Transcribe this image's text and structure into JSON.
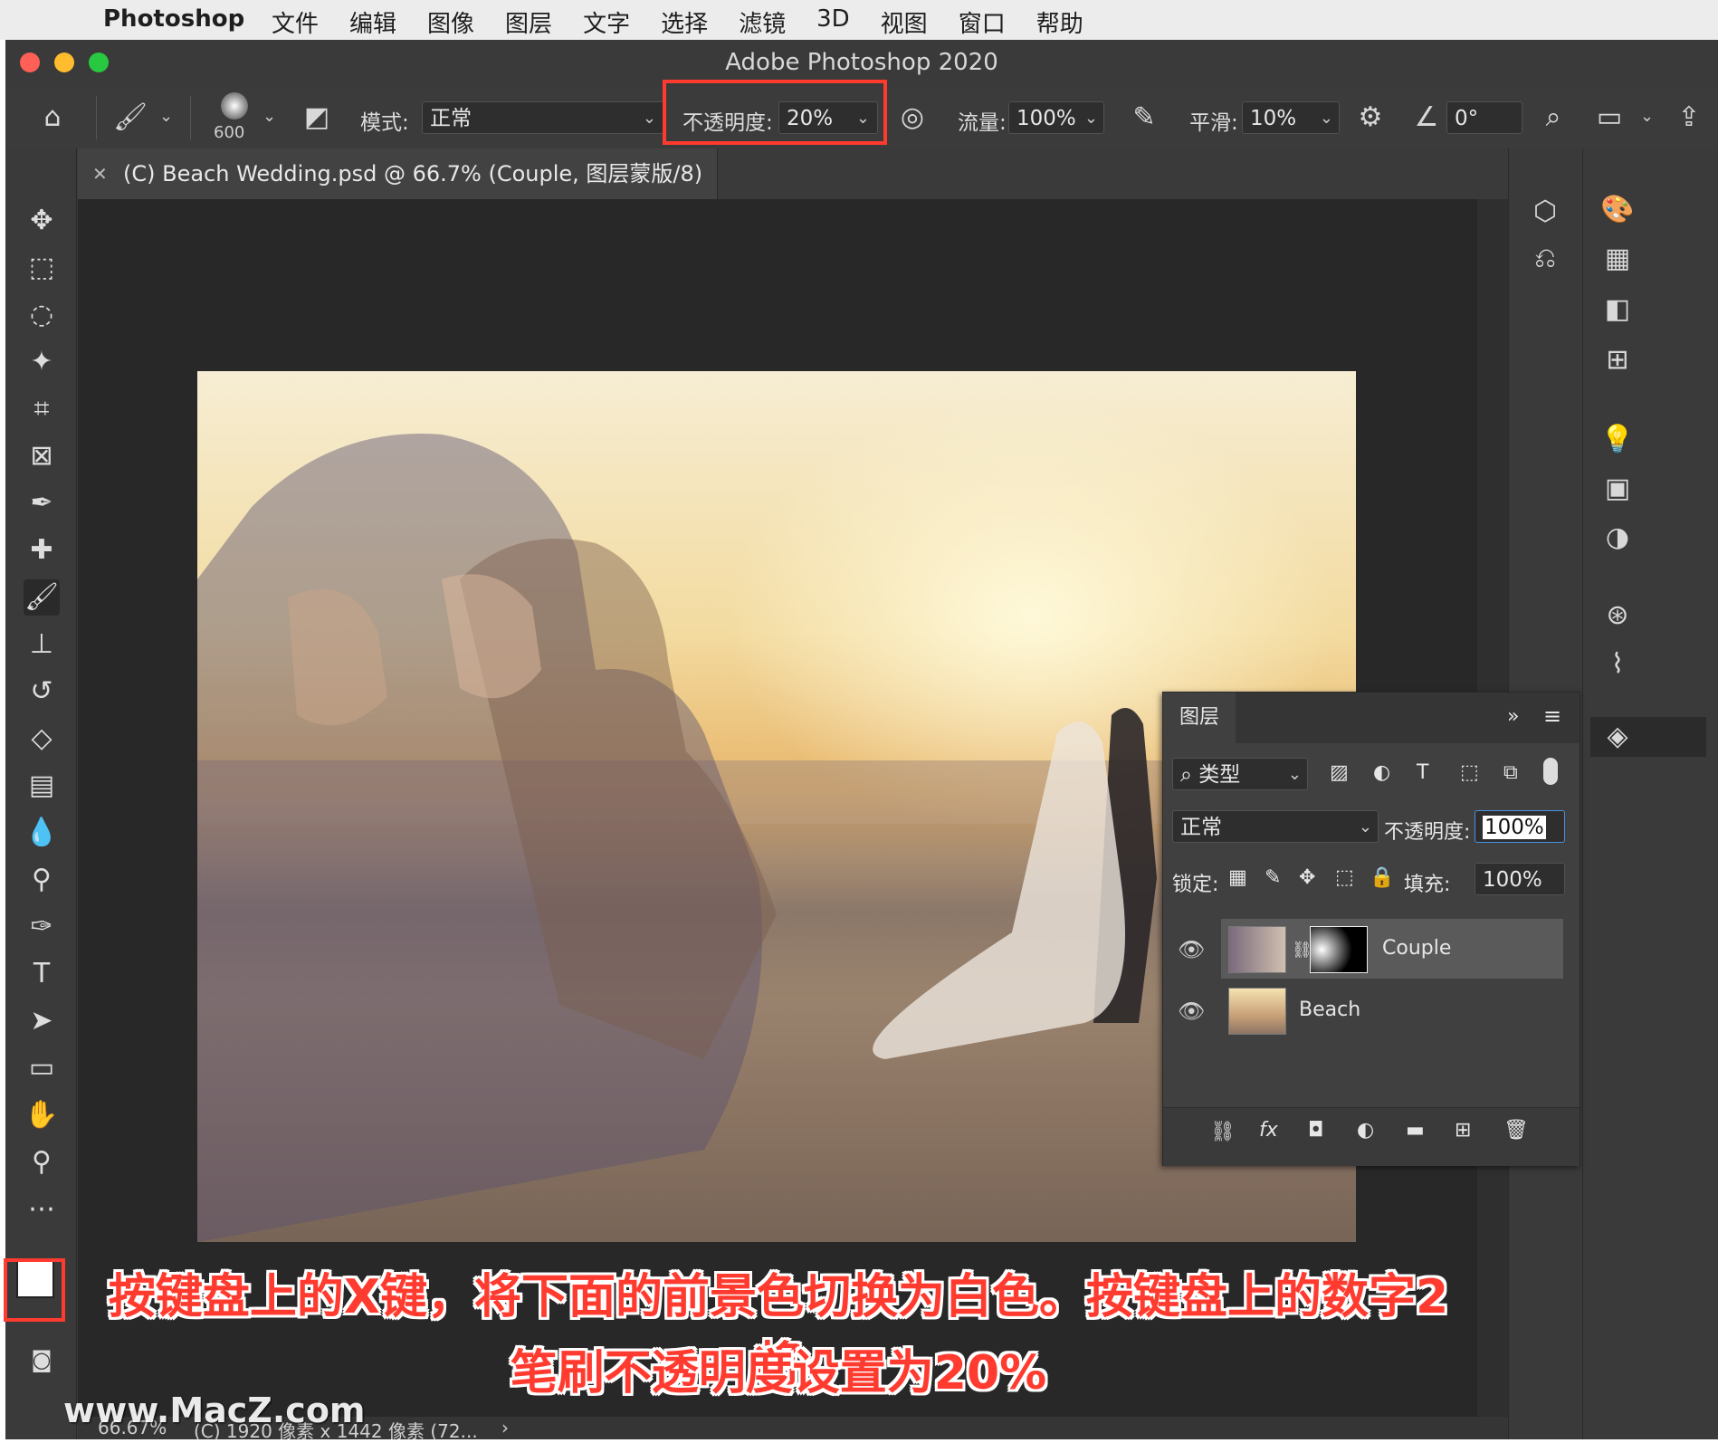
{
  "menubar": {
    "app_name": "Photoshop",
    "items": [
      "文件",
      "编辑",
      "图像",
      "图层",
      "文字",
      "选择",
      "滤镜",
      "3D",
      "视图",
      "窗口",
      "帮助"
    ]
  },
  "window": {
    "title": "Adobe Photoshop 2020"
  },
  "options": {
    "brush_size": "600",
    "mode_label": "模式:",
    "mode_value": "正常",
    "opacity_label": "不透明度:",
    "opacity_value": "20%",
    "flow_label": "流量:",
    "flow_value": "100%",
    "smoothing_label": "平滑:",
    "smoothing_value": "10%",
    "angle_value": "0°"
  },
  "document": {
    "tab_title": "(C) Beach Wedding.psd @ 66.7% (Couple, 图层蒙版/8) *",
    "status_zoom": "66.67%",
    "status_info": "(C) 1920 像素 x 1442 像素 (72..."
  },
  "layers_panel": {
    "tab_label": "图层",
    "filter_label": "类型",
    "blend_mode": "正常",
    "opacity_label": "不透明度:",
    "opacity_value": "100%",
    "lock_label": "锁定:",
    "fill_label": "填充:",
    "fill_value": "100%",
    "layers": [
      {
        "name": "Couple"
      },
      {
        "name": "Beach"
      }
    ]
  },
  "captions": {
    "line1": "按键盘上的X键，将下面的前景色切换为白色。按键盘上的数字2将",
    "line2": "笔刷不透明度设置为20%"
  },
  "watermark": "www.MacZ.com",
  "colors": {
    "highlight": "#ff3b30",
    "panel_bg": "#3b3b3b",
    "canvas_bg": "#282828",
    "selected_layer": "#5a5a5a"
  }
}
